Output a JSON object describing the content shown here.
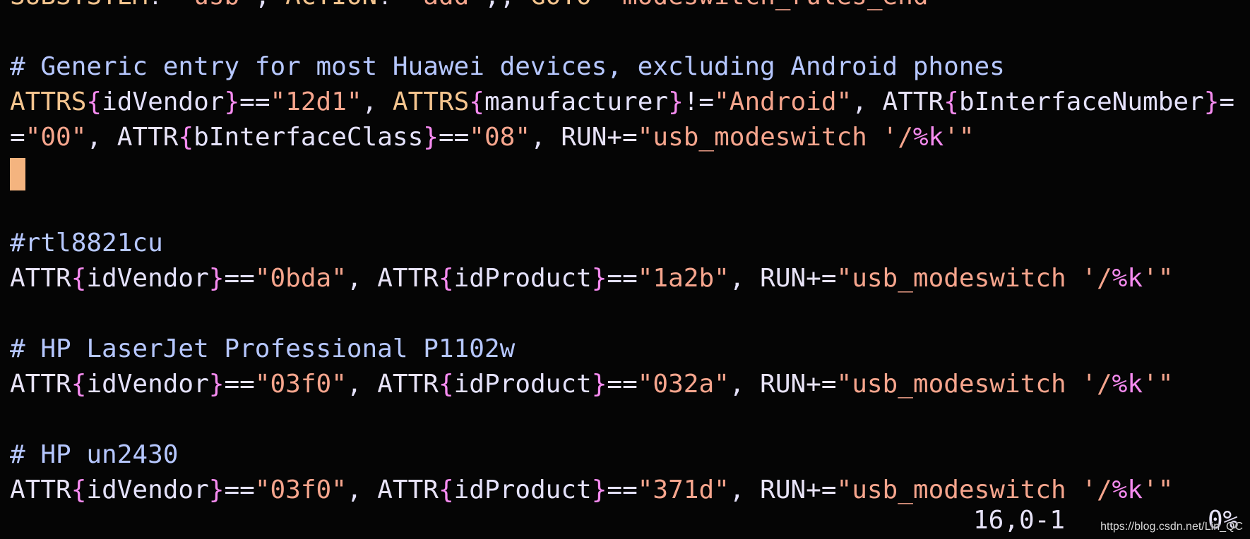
{
  "editor": {
    "lines": [
      {
        "type": "code",
        "tokens": [
          {
            "k": "kw",
            "t": "SUBSYSTEM"
          },
          {
            "k": "op",
            "t": "!="
          },
          {
            "k": "str",
            "t": "\"usb\""
          },
          {
            "k": "op",
            "t": ", "
          },
          {
            "k": "kw",
            "t": "ACTION"
          },
          {
            "k": "op",
            "t": "!="
          },
          {
            "k": "str",
            "t": "\"add\""
          },
          {
            "k": "op",
            "t": ",, "
          },
          {
            "k": "kw",
            "t": "GOTO"
          },
          {
            "k": "op",
            "t": "="
          },
          {
            "k": "str",
            "t": "\"modeswitch_rules_end\""
          }
        ]
      },
      {
        "type": "blank",
        "tokens": []
      },
      {
        "type": "comment",
        "tokens": [
          {
            "k": "comment",
            "t": "# Generic entry for most Huawei devices, excluding Android phones"
          }
        ]
      },
      {
        "type": "code",
        "tokens": [
          {
            "k": "kw",
            "t": "ATTRS"
          },
          {
            "k": "br",
            "t": "{"
          },
          {
            "k": "attr",
            "t": "idVendor"
          },
          {
            "k": "br",
            "t": "}"
          },
          {
            "k": "op",
            "t": "=="
          },
          {
            "k": "str",
            "t": "\"12d1\""
          },
          {
            "k": "op",
            "t": ", "
          },
          {
            "k": "kw",
            "t": "ATTRS"
          },
          {
            "k": "br",
            "t": "{"
          },
          {
            "k": "attr",
            "t": "manufacturer"
          },
          {
            "k": "br",
            "t": "}"
          },
          {
            "k": "op",
            "t": "!="
          },
          {
            "k": "str",
            "t": "\"Android\""
          },
          {
            "k": "op",
            "t": ", "
          },
          {
            "k": "plain",
            "t": "ATTR"
          },
          {
            "k": "br",
            "t": "{"
          },
          {
            "k": "attr",
            "t": "bInterfaceNumber"
          },
          {
            "k": "br",
            "t": "}"
          },
          {
            "k": "op",
            "t": "="
          }
        ]
      },
      {
        "type": "code",
        "tokens": [
          {
            "k": "op",
            "t": "="
          },
          {
            "k": "str",
            "t": "\"00\""
          },
          {
            "k": "op",
            "t": ", "
          },
          {
            "k": "plain",
            "t": "ATTR"
          },
          {
            "k": "br",
            "t": "{"
          },
          {
            "k": "attr",
            "t": "bInterfaceClass"
          },
          {
            "k": "br",
            "t": "}"
          },
          {
            "k": "op",
            "t": "=="
          },
          {
            "k": "str",
            "t": "\"08\""
          },
          {
            "k": "op",
            "t": ", "
          },
          {
            "k": "plain",
            "t": "RUN+="
          },
          {
            "k": "str",
            "t": "\"usb_modeswitch '/"
          },
          {
            "k": "pct",
            "t": "%k"
          },
          {
            "k": "str",
            "t": "'\""
          }
        ]
      },
      {
        "type": "cursor",
        "tokens": []
      },
      {
        "type": "blank",
        "tokens": []
      },
      {
        "type": "comment",
        "tokens": [
          {
            "k": "comment",
            "t": "#rtl8821cu"
          }
        ]
      },
      {
        "type": "code",
        "tokens": [
          {
            "k": "plain",
            "t": "ATTR"
          },
          {
            "k": "br",
            "t": "{"
          },
          {
            "k": "attr",
            "t": "idVendor"
          },
          {
            "k": "br",
            "t": "}"
          },
          {
            "k": "op",
            "t": "=="
          },
          {
            "k": "str",
            "t": "\"0bda\""
          },
          {
            "k": "op",
            "t": ", "
          },
          {
            "k": "plain",
            "t": "ATTR"
          },
          {
            "k": "br",
            "t": "{"
          },
          {
            "k": "attr",
            "t": "idProduct"
          },
          {
            "k": "br",
            "t": "}"
          },
          {
            "k": "op",
            "t": "=="
          },
          {
            "k": "str",
            "t": "\"1a2b\""
          },
          {
            "k": "op",
            "t": ", "
          },
          {
            "k": "plain",
            "t": "RUN+="
          },
          {
            "k": "str",
            "t": "\"usb_modeswitch '/"
          },
          {
            "k": "pct",
            "t": "%k"
          },
          {
            "k": "str",
            "t": "'\""
          }
        ]
      },
      {
        "type": "blank",
        "tokens": []
      },
      {
        "type": "comment",
        "tokens": [
          {
            "k": "comment",
            "t": "# HP LaserJet Professional P1102w"
          }
        ]
      },
      {
        "type": "code",
        "tokens": [
          {
            "k": "plain",
            "t": "ATTR"
          },
          {
            "k": "br",
            "t": "{"
          },
          {
            "k": "attr",
            "t": "idVendor"
          },
          {
            "k": "br",
            "t": "}"
          },
          {
            "k": "op",
            "t": "=="
          },
          {
            "k": "str",
            "t": "\"03f0\""
          },
          {
            "k": "op",
            "t": ", "
          },
          {
            "k": "plain",
            "t": "ATTR"
          },
          {
            "k": "br",
            "t": "{"
          },
          {
            "k": "attr",
            "t": "idProduct"
          },
          {
            "k": "br",
            "t": "}"
          },
          {
            "k": "op",
            "t": "=="
          },
          {
            "k": "str",
            "t": "\"032a\""
          },
          {
            "k": "op",
            "t": ", "
          },
          {
            "k": "plain",
            "t": "RUN+="
          },
          {
            "k": "str",
            "t": "\"usb_modeswitch '/"
          },
          {
            "k": "pct",
            "t": "%k"
          },
          {
            "k": "str",
            "t": "'\""
          }
        ]
      },
      {
        "type": "blank",
        "tokens": []
      },
      {
        "type": "comment",
        "tokens": [
          {
            "k": "comment",
            "t": "# HP un2430"
          }
        ]
      },
      {
        "type": "code",
        "tokens": [
          {
            "k": "plain",
            "t": "ATTR"
          },
          {
            "k": "br",
            "t": "{"
          },
          {
            "k": "attr",
            "t": "idVendor"
          },
          {
            "k": "br",
            "t": "}"
          },
          {
            "k": "op",
            "t": "=="
          },
          {
            "k": "str",
            "t": "\"03f0\""
          },
          {
            "k": "op",
            "t": ", "
          },
          {
            "k": "plain",
            "t": "ATTR"
          },
          {
            "k": "br",
            "t": "{"
          },
          {
            "k": "attr",
            "t": "idProduct"
          },
          {
            "k": "br",
            "t": "}"
          },
          {
            "k": "op",
            "t": "=="
          },
          {
            "k": "str",
            "t": "\"371d\""
          },
          {
            "k": "op",
            "t": ", "
          },
          {
            "k": "plain",
            "t": "RUN+="
          },
          {
            "k": "str",
            "t": "\"usb_modeswitch '/"
          },
          {
            "k": "pct",
            "t": "%k"
          },
          {
            "k": "str",
            "t": "'\""
          }
        ]
      }
    ]
  },
  "status": {
    "cursor_position": "16,0-1",
    "scroll_percent": "0%"
  },
  "watermark": "https://blog.csdn.net/Lin_QC",
  "colors": {
    "background": "#050505",
    "keyword": "#f5c58f",
    "brace": "#f68bf0",
    "string": "#f6a58d",
    "comment": "#b6c7ff",
    "text": "#e4e1fb",
    "cursor": "#f4b47f"
  }
}
